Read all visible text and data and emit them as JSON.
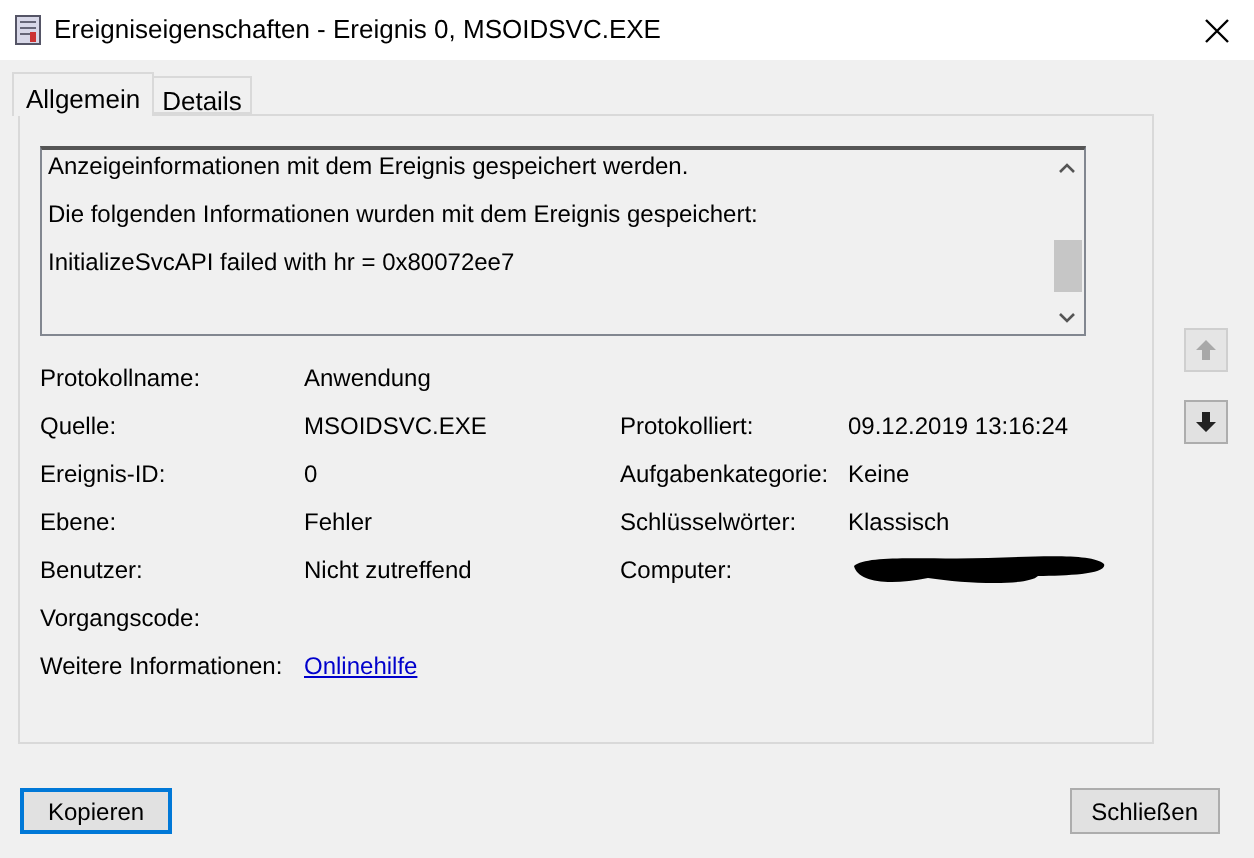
{
  "window": {
    "title": "Ereigniseigenschaften - Ereignis 0, MSOIDSVC.EXE"
  },
  "tabs": [
    {
      "label": "Allgemein",
      "selected": true
    },
    {
      "label": "Details",
      "selected": false
    }
  ],
  "description": [
    "Anzeigeinformationen mit dem Ereignis gespeichert werden.",
    "Die folgenden Informationen wurden mit dem Ereignis gespeichert:",
    "InitializeSvcAPI failed with hr = 0x80072ee7"
  ],
  "rows": [
    {
      "left": {
        "label": "Protokollname:",
        "value": "Anwendung",
        "kind": "text"
      }
    },
    {
      "left": {
        "label": "Quelle:",
        "value": "MSOIDSVC.EXE",
        "kind": "text"
      },
      "right": {
        "label": "Protokolliert:",
        "value": "09.12.2019 13:16:24",
        "kind": "text"
      }
    },
    {
      "left": {
        "label": "Ereignis-ID:",
        "value": "0",
        "kind": "text"
      },
      "right": {
        "label": "Aufgabenkategorie:",
        "value": "Keine",
        "kind": "text"
      }
    },
    {
      "left": {
        "label": "Ebene:",
        "value": "Fehler",
        "kind": "text"
      },
      "right": {
        "label": "Schlüsselwörter:",
        "value": "Klassisch",
        "kind": "text"
      }
    },
    {
      "left": {
        "label": "Benutzer:",
        "value": "Nicht zutreffend",
        "kind": "text"
      },
      "right": {
        "label": "Computer:",
        "kind": "redacted"
      }
    },
    {
      "left": {
        "label": "Vorgangscode:",
        "kind": "empty"
      }
    },
    {
      "left": {
        "label": "Weitere Informationen:",
        "value": "Onlinehilfe",
        "kind": "link"
      }
    }
  ],
  "navigation": [
    {
      "kind": "up",
      "disabled": true
    },
    {
      "kind": "down",
      "disabled": false
    }
  ],
  "buttons": [
    {
      "label": "Kopieren",
      "default": true
    },
    {
      "label": "Schließen",
      "default": false
    }
  ]
}
